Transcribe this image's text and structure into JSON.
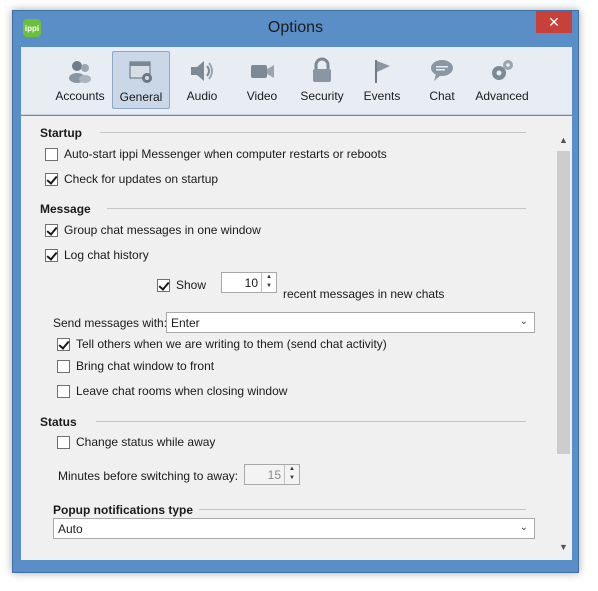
{
  "window": {
    "title": "Options",
    "app_icon_text": "ippi",
    "close_glyph": "✕"
  },
  "tabs": [
    {
      "label": "Accounts",
      "icon": "accounts-icon"
    },
    {
      "label": "General",
      "icon": "general-icon",
      "active": true
    },
    {
      "label": "Audio",
      "icon": "speaker-icon"
    },
    {
      "label": "Video",
      "icon": "camera-icon"
    },
    {
      "label": "Security",
      "icon": "lock-icon"
    },
    {
      "label": "Events",
      "icon": "flag-icon"
    },
    {
      "label": "Chat",
      "icon": "speech-bubble-icon"
    },
    {
      "label": "Advanced",
      "icon": "gears-icon"
    }
  ],
  "startup": {
    "heading": "Startup",
    "autostart": {
      "label": "Auto-start ippi Messenger when computer restarts or reboots",
      "checked": false
    },
    "check_updates": {
      "label": "Check for updates on startup",
      "checked": true
    }
  },
  "message": {
    "heading": "Message",
    "group_chat": {
      "label": "Group chat messages in one window",
      "checked": true
    },
    "log_history": {
      "label": "Log chat history",
      "checked": true
    },
    "show": {
      "label": "Show",
      "checked": true,
      "count": "10",
      "suffix": "recent messages in new chats"
    },
    "send_with": {
      "label": "Send messages with:",
      "value": "Enter"
    },
    "tell_others": {
      "label": "Tell others when we are writing to them (send chat activity)",
      "checked": true
    },
    "bring_front": {
      "label": "Bring chat window to front",
      "checked": false
    },
    "leave_rooms": {
      "label": "Leave chat rooms when closing window",
      "checked": false
    }
  },
  "status": {
    "heading": "Status",
    "change_away": {
      "label": "Change status while away",
      "checked": false
    },
    "minutes": {
      "label": "Minutes before switching to away:",
      "value": "15"
    }
  },
  "popup": {
    "heading": "Popup notifications type",
    "value": "Auto"
  },
  "glyphs": {
    "chev": "⌄",
    "up": "▲",
    "down": "▼"
  },
  "colors": {
    "frame": "#5a8ec7",
    "close": "#c7413a",
    "tab_active": "#c9d7e6"
  }
}
